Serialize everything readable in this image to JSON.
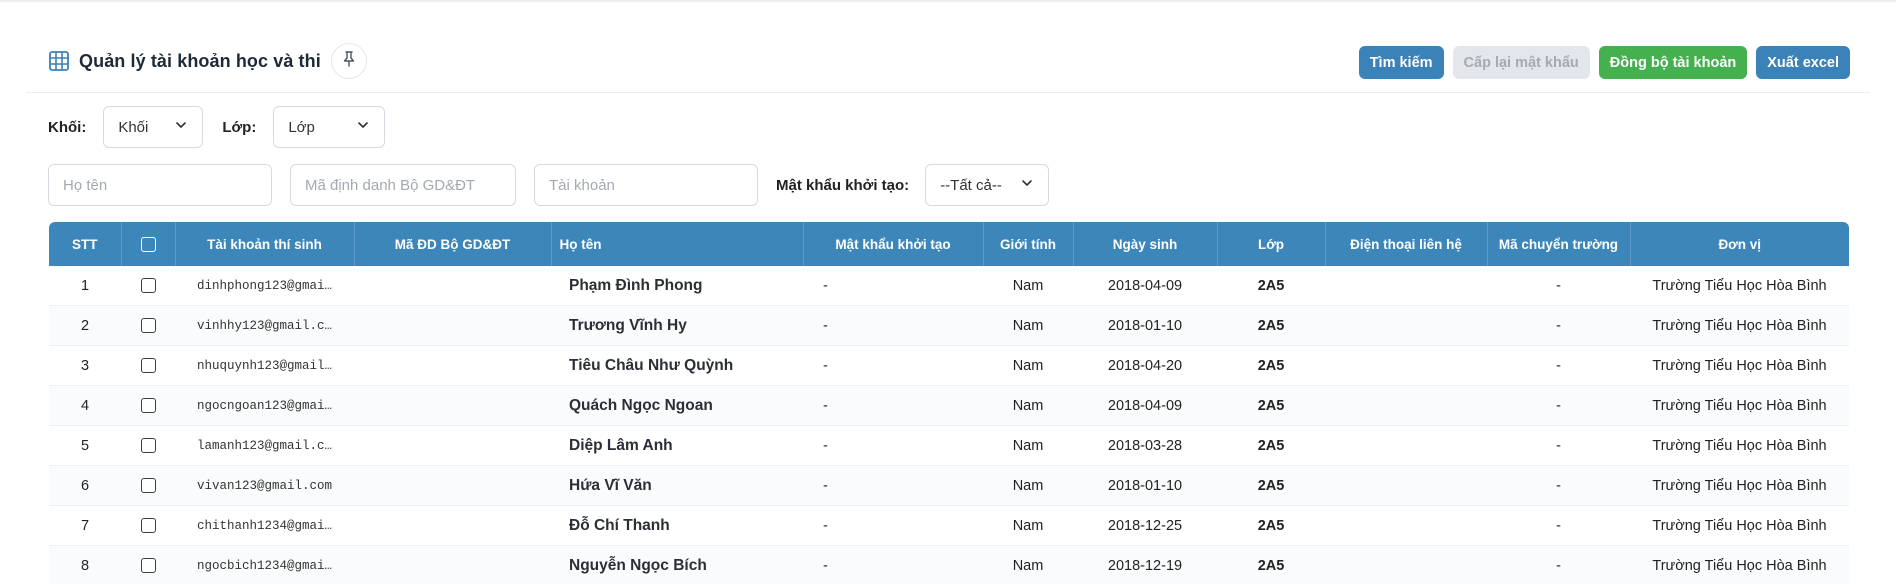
{
  "page": {
    "title": "Quản lý tài khoản học và thi"
  },
  "actions": {
    "search": "Tìm kiếm",
    "reset_password": "Cấp lại mật khẩu",
    "sync_accounts": "Đồng bộ tài khoản",
    "export_excel": "Xuất excel"
  },
  "filters": {
    "grade_label": "Khối:",
    "grade_value": "Khối",
    "class_label": "Lớp:",
    "class_value": "Lớp",
    "name_placeholder": "Họ tên",
    "moet_id_placeholder": "Mã định danh Bộ GD&ĐT",
    "account_placeholder": "Tài khoản",
    "initial_password_label": "Mật khẩu khởi tạo:",
    "initial_password_value": "--Tất cả--"
  },
  "table": {
    "columns": [
      "STT",
      "",
      "Tài khoản thí sinh",
      "Mã ĐD Bộ GD&ĐT",
      "Họ tên",
      "Mật khẩu khởi tạo",
      "Giới tính",
      "Ngày sinh",
      "Lớp",
      "Điện thoại liên hệ",
      "Mã chuyển trường",
      "Đơn vị"
    ],
    "rows": [
      {
        "stt": "1",
        "account": "dinhphong123@gmai…",
        "moet_id": "",
        "name": "Phạm Đình Phong",
        "init_pw": "-",
        "gender": "Nam",
        "dob": "2018-04-09",
        "class": "2A5",
        "phone": "",
        "transfer": "-",
        "unit": "Trường Tiểu Học Hòa Bình"
      },
      {
        "stt": "2",
        "account": "vinhhy123@gmail.c…",
        "moet_id": "",
        "name": "Trương Vĩnh Hy",
        "init_pw": "-",
        "gender": "Nam",
        "dob": "2018-01-10",
        "class": "2A5",
        "phone": "",
        "transfer": "-",
        "unit": "Trường Tiểu Học Hòa Bình"
      },
      {
        "stt": "3",
        "account": "nhuquynh123@gmail…",
        "moet_id": "",
        "name": "Tiêu Châu Như Quỳnh",
        "init_pw": "-",
        "gender": "Nam",
        "dob": "2018-04-20",
        "class": "2A5",
        "phone": "",
        "transfer": "-",
        "unit": "Trường Tiểu Học Hòa Bình"
      },
      {
        "stt": "4",
        "account": "ngocngoan123@gmai…",
        "moet_id": "",
        "name": "Quách Ngọc Ngoan",
        "init_pw": "-",
        "gender": "Nam",
        "dob": "2018-04-09",
        "class": "2A5",
        "phone": "",
        "transfer": "-",
        "unit": "Trường Tiểu Học Hòa Bình"
      },
      {
        "stt": "5",
        "account": "lamanh123@gmail.c…",
        "moet_id": "",
        "name": "Diệp Lâm Anh",
        "init_pw": "-",
        "gender": "Nam",
        "dob": "2018-03-28",
        "class": "2A5",
        "phone": "",
        "transfer": "-",
        "unit": "Trường Tiểu Học Hòa Bình"
      },
      {
        "stt": "6",
        "account": "vivan123@gmail.com",
        "moet_id": "",
        "name": "Hứa Vĩ Văn",
        "init_pw": "-",
        "gender": "Nam",
        "dob": "2018-01-10",
        "class": "2A5",
        "phone": "",
        "transfer": "-",
        "unit": "Trường Tiểu Học Hòa Bình"
      },
      {
        "stt": "7",
        "account": "chithanh1234@gmai…",
        "moet_id": "",
        "name": "Đỗ Chí Thanh",
        "init_pw": "-",
        "gender": "Nam",
        "dob": "2018-12-25",
        "class": "2A5",
        "phone": "",
        "transfer": "-",
        "unit": "Trường Tiểu Học Hòa Bình"
      },
      {
        "stt": "8",
        "account": "ngocbich1234@gmai…",
        "moet_id": "",
        "name": "Nguyễn Ngọc Bích",
        "init_pw": "-",
        "gender": "Nam",
        "dob": "2018-12-19",
        "class": "2A5",
        "phone": "",
        "transfer": "-",
        "unit": "Trường Tiểu Học Hòa Bình"
      }
    ]
  },
  "colors": {
    "primary": "#3b82b8",
    "success": "#44b04e",
    "disabled": "#e3e6ea",
    "table_header": "#3d86ba"
  },
  "icons": {
    "title_icon": "table-grid-icon",
    "pin_icon": "pin-icon",
    "dropdown_icon": "chevron-down-icon"
  }
}
